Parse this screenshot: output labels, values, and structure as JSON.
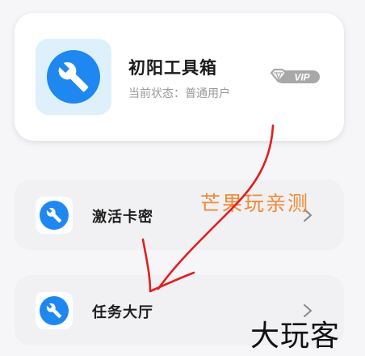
{
  "profile": {
    "app_name": "初阳工具箱",
    "status_label": "当前状态：",
    "status_value": "普通用户",
    "badge_text": "VIP",
    "logo_icon": "wrench-icon"
  },
  "menu": {
    "items": [
      {
        "label": "激活卡密",
        "icon": "wrench-icon"
      },
      {
        "label": "任务大厅",
        "icon": "wrench-icon"
      }
    ]
  },
  "overlay": {
    "annotation_text": "芒果玩亲测",
    "watermark_text": "大玩客"
  },
  "colors": {
    "accent": "#1e88f0",
    "annotation": "#f08a3a",
    "arrow": "#e02020"
  }
}
